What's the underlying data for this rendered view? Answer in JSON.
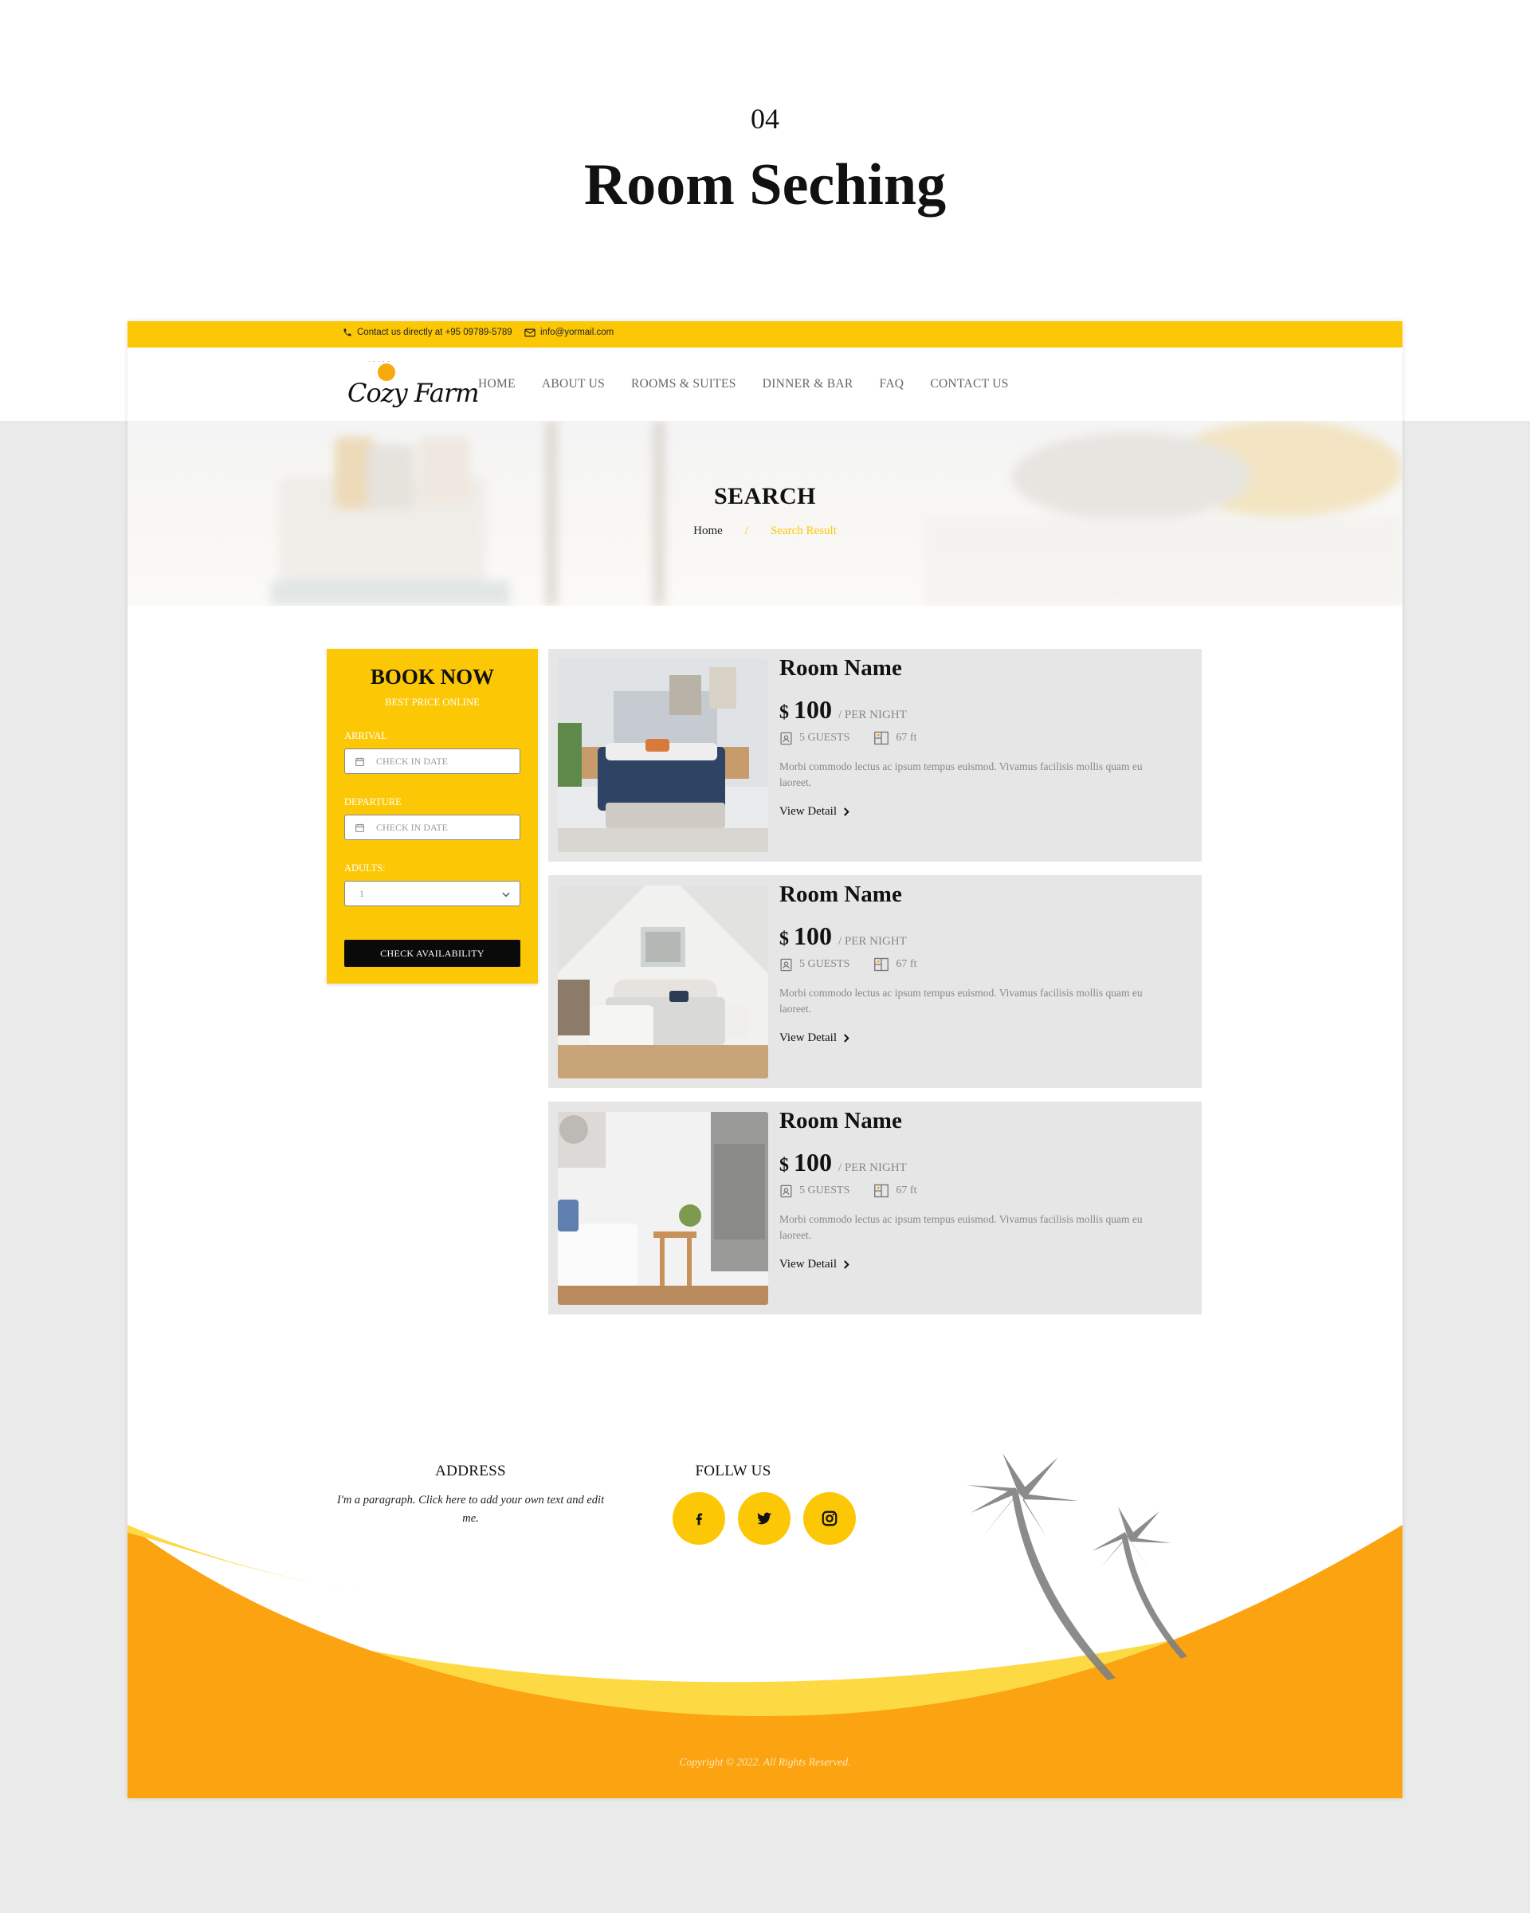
{
  "sheet": {
    "number": "04",
    "title": "Room Seching"
  },
  "topbar": {
    "contact": "Contact us directly at +95 09789-5789",
    "email": "info@yormail.com"
  },
  "logo": {
    "brand": "Cozy Farm",
    "tagline": "· · · · ·"
  },
  "nav": [
    "HOME",
    "ABOUT US",
    "ROOMS & SUITES",
    "DINNER & BAR",
    "FAQ",
    "CONTACT US"
  ],
  "hero": {
    "title": "SEARCH",
    "breadcrumb": {
      "home": "Home",
      "separator": "/",
      "current": "Search Result"
    }
  },
  "booking": {
    "title": "BOOK NOW",
    "subtitle": "BEST PRICE ONLINE",
    "arrival_label": "ARRIVAL",
    "arrival_placeholder": "CHECK IN DATE",
    "departure_label": "DEPARTURE",
    "departure_placeholder": "CHECK IN DATE",
    "adults_label": "ADULTS:",
    "adults_value": "1",
    "button": "CHECK AVAILABILITY"
  },
  "rooms": [
    {
      "name": "Room Name",
      "currency": "$",
      "price": "100",
      "per": "/ PER NIGHT",
      "guests": "5 GUESTS",
      "size": "67 ft",
      "description": "Morbi commodo lectus ac ipsum tempus euismod. Vivamus facilisis mollis quam eu laoreet.",
      "link": "View Detail"
    },
    {
      "name": "Room Name",
      "currency": "$",
      "price": "100",
      "per": "/ PER NIGHT",
      "guests": "5 GUESTS",
      "size": "67 ft",
      "description": "Morbi commodo lectus ac ipsum tempus euismod. Vivamus facilisis mollis quam eu laoreet.",
      "link": "View Detail"
    },
    {
      "name": "Room Name",
      "currency": "$",
      "price": "100",
      "per": "/ PER NIGHT",
      "guests": "5 GUESTS",
      "size": "67 ft",
      "description": "Morbi commodo lectus ac ipsum tempus euismod. Vivamus facilisis mollis quam eu laoreet.",
      "link": "View Detail"
    }
  ],
  "footer": {
    "address_title": "ADDRESS",
    "address_text": "I'm a paragraph. Click here to add your own text and edit me.",
    "follow_title": "FOLLW US",
    "social": [
      "facebook-icon",
      "twitter-icon",
      "instagram-icon"
    ],
    "copyright": "Copyright © 2022. All Rights Reserved."
  },
  "colors": {
    "accent_yellow": "#fcc806",
    "footer_orange": "#fba310",
    "footer_light_yellow": "#fdd944",
    "card_grey": "#e6e6e6",
    "page_grey": "#eaeaea"
  }
}
